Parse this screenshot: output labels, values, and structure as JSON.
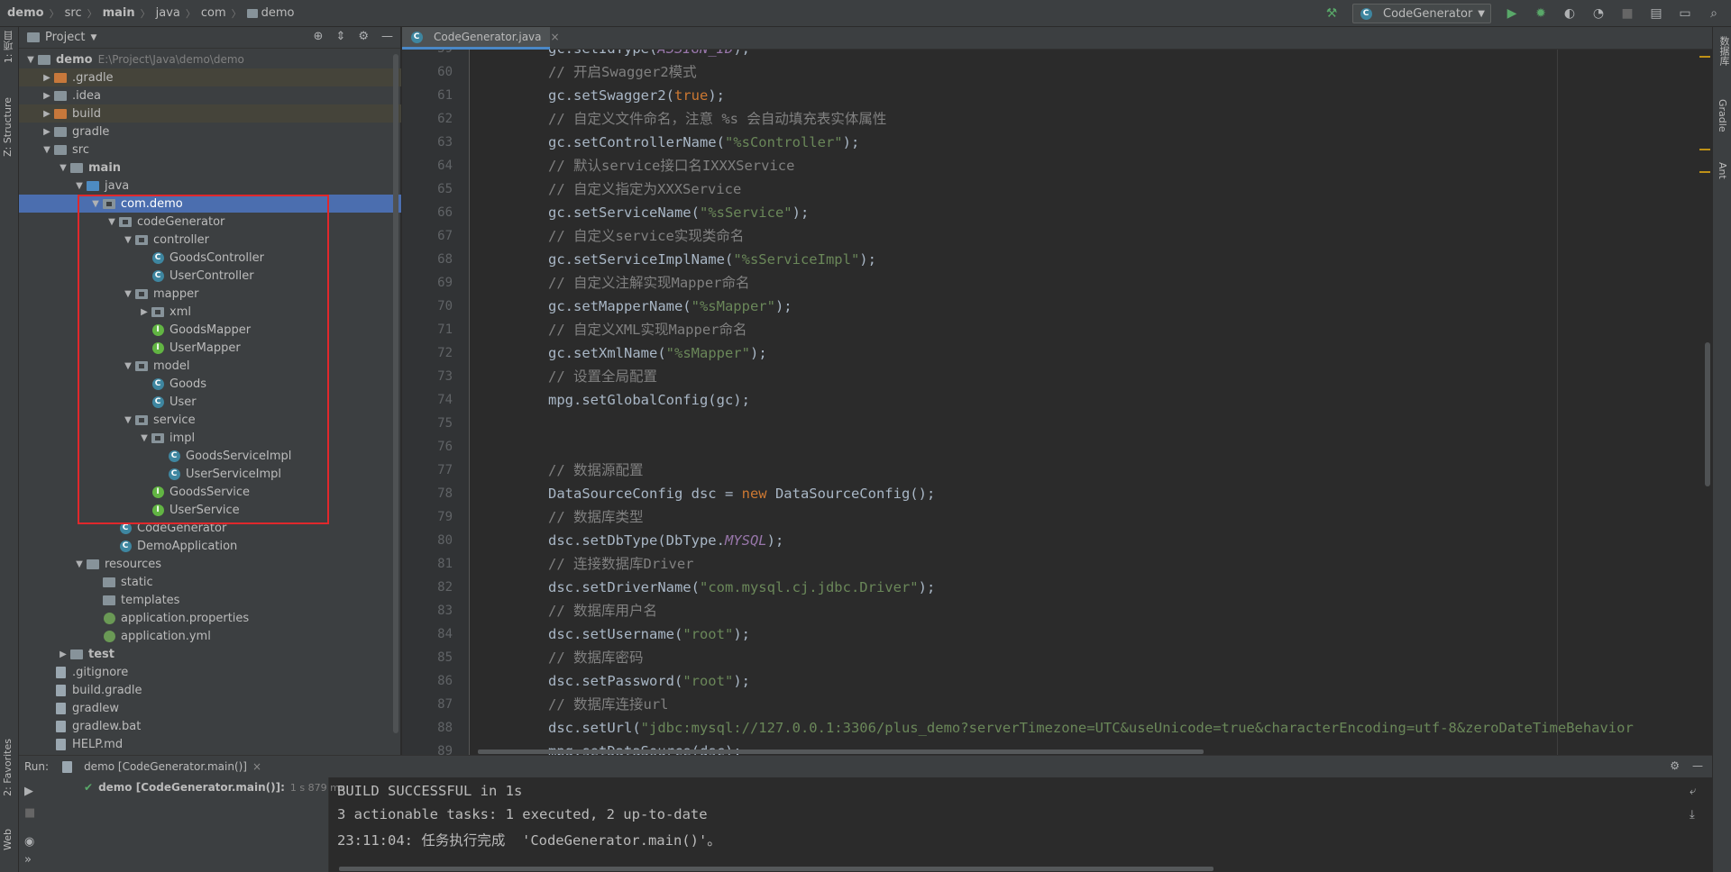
{
  "breadcrumb": [
    "demo",
    "src",
    "main",
    "java",
    "com",
    "demo"
  ],
  "run_config": "CodeGenerator",
  "project_panel": {
    "title": "Project"
  },
  "left_strip": {
    "project": "1: 项目",
    "structure": "Z: Structure",
    "favorites": "2: Favorites",
    "web": "Web"
  },
  "right_strip": {
    "database": "数据库",
    "gradle": "Gradle",
    "ant": "Ant"
  },
  "tree": [
    {
      "label": "demo",
      "depth": 0,
      "arrow": "down",
      "icon": "folder",
      "bold": true,
      "extra": "E:\\Project\\Java\\demo\\demo"
    },
    {
      "label": ".gradle",
      "depth": 1,
      "arrow": "right",
      "icon": "folder-orange",
      "excluded": true
    },
    {
      "label": ".idea",
      "depth": 1,
      "arrow": "right",
      "icon": "folder"
    },
    {
      "label": "build",
      "depth": 1,
      "arrow": "right",
      "icon": "folder-orange",
      "excluded": true
    },
    {
      "label": "gradle",
      "depth": 1,
      "arrow": "right",
      "icon": "folder"
    },
    {
      "label": "src",
      "depth": 1,
      "arrow": "down",
      "icon": "folder"
    },
    {
      "label": "main",
      "depth": 2,
      "arrow": "down",
      "icon": "folder",
      "bold": true
    },
    {
      "label": "java",
      "depth": 3,
      "arrow": "down",
      "icon": "folder-blue"
    },
    {
      "label": "com.demo",
      "depth": 4,
      "arrow": "down",
      "icon": "package",
      "selected": true
    },
    {
      "label": "codeGenerator",
      "depth": 5,
      "arrow": "down",
      "icon": "package"
    },
    {
      "label": "controller",
      "depth": 6,
      "arrow": "down",
      "icon": "package"
    },
    {
      "label": "GoodsController",
      "depth": 7,
      "icon": "class"
    },
    {
      "label": "UserController",
      "depth": 7,
      "icon": "class"
    },
    {
      "label": "mapper",
      "depth": 6,
      "arrow": "down",
      "icon": "package"
    },
    {
      "label": "xml",
      "depth": 7,
      "arrow": "right",
      "icon": "package"
    },
    {
      "label": "GoodsMapper",
      "depth": 7,
      "icon": "interface"
    },
    {
      "label": "UserMapper",
      "depth": 7,
      "icon": "interface"
    },
    {
      "label": "model",
      "depth": 6,
      "arrow": "down",
      "icon": "package"
    },
    {
      "label": "Goods",
      "depth": 7,
      "icon": "class"
    },
    {
      "label": "User",
      "depth": 7,
      "icon": "class"
    },
    {
      "label": "service",
      "depth": 6,
      "arrow": "down",
      "icon": "package"
    },
    {
      "label": "impl",
      "depth": 7,
      "arrow": "down",
      "icon": "package"
    },
    {
      "label": "GoodsServiceImpl",
      "depth": 8,
      "icon": "class"
    },
    {
      "label": "UserServiceImpl",
      "depth": 8,
      "icon": "class"
    },
    {
      "label": "GoodsService",
      "depth": 7,
      "icon": "interface"
    },
    {
      "label": "UserService",
      "depth": 7,
      "icon": "interface"
    },
    {
      "label": "CodeGenerator",
      "depth": 5,
      "icon": "class"
    },
    {
      "label": "DemoApplication",
      "depth": 5,
      "icon": "class"
    },
    {
      "label": "resources",
      "depth": 3,
      "arrow": "down",
      "icon": "folder"
    },
    {
      "label": "static",
      "depth": 4,
      "icon": "folder"
    },
    {
      "label": "templates",
      "depth": 4,
      "icon": "folder"
    },
    {
      "label": "application.properties",
      "depth": 4,
      "icon": "leaf"
    },
    {
      "label": "application.yml",
      "depth": 4,
      "icon": "leaf"
    },
    {
      "label": "test",
      "depth": 2,
      "arrow": "right",
      "icon": "folder",
      "bold": true
    },
    {
      "label": ".gitignore",
      "depth": 1,
      "icon": "file"
    },
    {
      "label": "build.gradle",
      "depth": 1,
      "icon": "file"
    },
    {
      "label": "gradlew",
      "depth": 1,
      "icon": "file"
    },
    {
      "label": "gradlew.bat",
      "depth": 1,
      "icon": "file"
    },
    {
      "label": "HELP.md",
      "depth": 1,
      "icon": "file"
    }
  ],
  "editor": {
    "tab": "CodeGenerator.java",
    "lines": [
      {
        "n": "59",
        "tokens": [
          [
            "p",
            "gc.setIdType("
          ],
          [
            "k",
            "ASSIGN_ID"
          ],
          [
            "p",
            ");"
          ]
        ]
      },
      {
        "n": "60",
        "tokens": [
          [
            "c",
            "// 开启Swagger2模式"
          ]
        ]
      },
      {
        "n": "61",
        "tokens": [
          [
            "p",
            "gc.setSwagger2("
          ],
          [
            "w",
            "true"
          ],
          [
            "p",
            ");"
          ]
        ]
      },
      {
        "n": "62",
        "tokens": [
          [
            "c",
            "// 自定义文件命名，注意 %s 会自动填充表实体属性"
          ]
        ]
      },
      {
        "n": "63",
        "tokens": [
          [
            "p",
            "gc.setControllerName("
          ],
          [
            "s",
            "\"%sController\""
          ],
          [
            "p",
            ");"
          ]
        ]
      },
      {
        "n": "64",
        "tokens": [
          [
            "c",
            "// 默认service接口名IXXXService"
          ]
        ]
      },
      {
        "n": "65",
        "tokens": [
          [
            "c",
            "// 自定义指定为XXXService"
          ]
        ]
      },
      {
        "n": "66",
        "tokens": [
          [
            "p",
            "gc.setServiceName("
          ],
          [
            "s",
            "\"%sService\""
          ],
          [
            "p",
            ");"
          ]
        ]
      },
      {
        "n": "67",
        "tokens": [
          [
            "c",
            "// 自定义service实现类命名"
          ]
        ]
      },
      {
        "n": "68",
        "tokens": [
          [
            "p",
            "gc.setServiceImplName("
          ],
          [
            "s",
            "\"%sServiceImpl\""
          ],
          [
            "p",
            ");"
          ]
        ]
      },
      {
        "n": "69",
        "tokens": [
          [
            "c",
            "// 自定义注解实现Mapper命名"
          ]
        ]
      },
      {
        "n": "70",
        "tokens": [
          [
            "p",
            "gc.setMapperName("
          ],
          [
            "s",
            "\"%sMapper\""
          ],
          [
            "p",
            ");"
          ]
        ]
      },
      {
        "n": "71",
        "tokens": [
          [
            "c",
            "// 自定义XML实现Mapper命名"
          ]
        ]
      },
      {
        "n": "72",
        "tokens": [
          [
            "p",
            "gc.setXmlName("
          ],
          [
            "s",
            "\"%sMapper\""
          ],
          [
            "p",
            ");"
          ]
        ]
      },
      {
        "n": "73",
        "tokens": [
          [
            "c",
            "// 设置全局配置"
          ]
        ]
      },
      {
        "n": "74",
        "tokens": [
          [
            "p",
            "mpg.setGlobalConfig(gc);"
          ]
        ]
      },
      {
        "n": "75",
        "tokens": []
      },
      {
        "n": "76",
        "tokens": []
      },
      {
        "n": "77",
        "tokens": [
          [
            "c",
            "// 数据源配置"
          ]
        ]
      },
      {
        "n": "78",
        "tokens": [
          [
            "p",
            "DataSourceConfig dsc = "
          ],
          [
            "w",
            "new"
          ],
          [
            "p",
            " DataSourceConfig();"
          ]
        ]
      },
      {
        "n": "79",
        "tokens": [
          [
            "c",
            "// 数据库类型"
          ]
        ]
      },
      {
        "n": "80",
        "tokens": [
          [
            "p",
            "dsc.setDbType(DbType."
          ],
          [
            "k",
            "MYSQL"
          ],
          [
            "p",
            ");"
          ]
        ]
      },
      {
        "n": "81",
        "tokens": [
          [
            "c",
            "// 连接数据库Driver"
          ]
        ]
      },
      {
        "n": "82",
        "tokens": [
          [
            "p",
            "dsc.setDriverName("
          ],
          [
            "s",
            "\"com.mysql.cj.jdbc.Driver\""
          ],
          [
            "p",
            ");"
          ]
        ]
      },
      {
        "n": "83",
        "tokens": [
          [
            "c",
            "// 数据库用户名"
          ]
        ]
      },
      {
        "n": "84",
        "tokens": [
          [
            "p",
            "dsc.setUsername("
          ],
          [
            "s",
            "\"root\""
          ],
          [
            "p",
            ");"
          ]
        ]
      },
      {
        "n": "85",
        "tokens": [
          [
            "c",
            "// 数据库密码"
          ]
        ]
      },
      {
        "n": "86",
        "tokens": [
          [
            "p",
            "dsc.setPassword("
          ],
          [
            "s",
            "\"root\""
          ],
          [
            "p",
            ");"
          ]
        ]
      },
      {
        "n": "87",
        "tokens": [
          [
            "c",
            "// 数据库连接url"
          ]
        ]
      },
      {
        "n": "88",
        "tokens": [
          [
            "p",
            "dsc.setUrl("
          ],
          [
            "s",
            "\"jdbc:mysql://127.0.0.1:3306/plus_demo?serverTimezone=UTC&useUnicode=true&characterEncoding=utf-8&zeroDateTimeBehavior"
          ]
        ]
      },
      {
        "n": "89",
        "tokens": [
          [
            "p",
            "mpg.setDataSource(dsc);"
          ]
        ]
      }
    ]
  },
  "run": {
    "label": "Run:",
    "tab": "demo [CodeGenerator.main()]",
    "item_name": "demo [CodeGenerator.main()]:",
    "item_time": "1 s 879 ms",
    "console": [
      "BUILD SUCCESSFUL in 1s",
      "3 actionable tasks: 1 executed, 2 up-to-date",
      "23:11:04: 任务执行完成  'CodeGenerator.main()'。"
    ]
  },
  "colors": {
    "selection": "#4b6eaf",
    "highlight_box": "#e0282c",
    "string": "#6a8759",
    "keyword": "#cc7832",
    "comment": "#808080",
    "constant": "#9876aa"
  }
}
